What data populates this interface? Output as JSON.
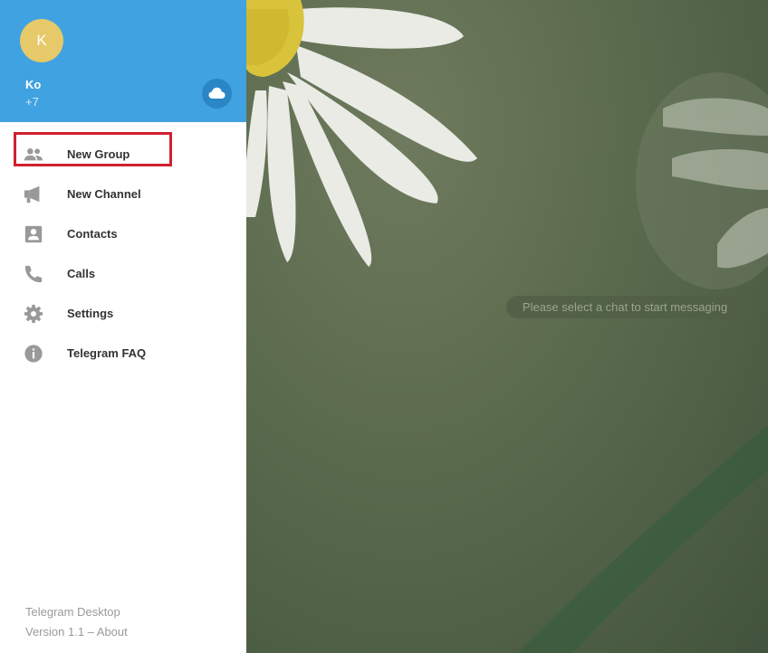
{
  "profile": {
    "avatar_initial": "K",
    "name": "Ko",
    "phone": "+7",
    "cloud_icon": "cloud-icon"
  },
  "menu": {
    "items": [
      {
        "label": "New Group",
        "icon": "group-icon"
      },
      {
        "label": "New Channel",
        "icon": "megaphone-icon"
      },
      {
        "label": "Contacts",
        "icon": "contact-card-icon"
      },
      {
        "label": "Calls",
        "icon": "phone-icon"
      },
      {
        "label": "Settings",
        "icon": "gear-icon"
      },
      {
        "label": "Telegram FAQ",
        "icon": "info-icon"
      }
    ]
  },
  "footer": {
    "app_name": "Telegram Desktop",
    "version": "Version 1.1 – About"
  },
  "chat": {
    "empty_message": "Please select a chat to start messaging"
  },
  "colors": {
    "header_blue": "#40a2e0",
    "avatar_yellow": "#e6c969",
    "highlight_red": "#d0202e"
  }
}
